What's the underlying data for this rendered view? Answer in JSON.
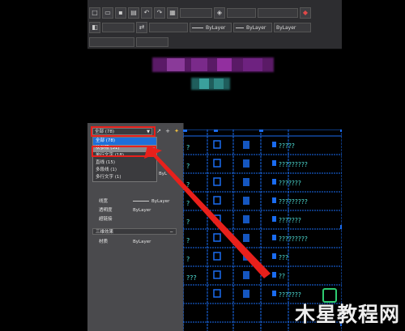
{
  "toolbar": {
    "row1_icons": [
      "new-icon",
      "open-icon",
      "save-icon",
      "print-icon",
      "undo-icon",
      "redo-icon",
      "properties-icon",
      "layer-icon"
    ],
    "bylayer_label": "ByLayer",
    "combos": [
      "",
      "",
      "ByLayer",
      "ByLayer",
      "ByLayer"
    ]
  },
  "panel": {
    "selection_combo": "全部 (78)",
    "dropdown_items": [
      "全部 (78)",
      "块参照 (31)",
      "单行文字 (18)",
      "直线 (15)",
      "多段线 (1)",
      "多行文字 (1)"
    ],
    "side_value": "ByL",
    "properties": [
      {
        "label": "线宽",
        "value": "ByLayer",
        "line": true
      },
      {
        "label": "透明度",
        "value": "ByLayer",
        "line": false
      },
      {
        "label": "超链接",
        "value": "",
        "line": false
      }
    ],
    "section_3d": "三维效果",
    "material_label": "材质",
    "material_value": "ByLayer"
  },
  "table": {
    "rows": [
      "?",
      "?",
      "?",
      "?",
      "?",
      "?",
      "?",
      "???"
    ],
    "text_col": [
      "?????",
      "?????????",
      "???????",
      "?????????",
      "???????",
      "?????????",
      "???",
      "??",
      "???????"
    ]
  },
  "watermark": "木星教程网",
  "colors": {
    "accent_red": "#e8201b",
    "selection_blue": "#1e6fd9",
    "cad_blue": "#1a6cf0",
    "text_cyan": "#4fe0d8"
  }
}
